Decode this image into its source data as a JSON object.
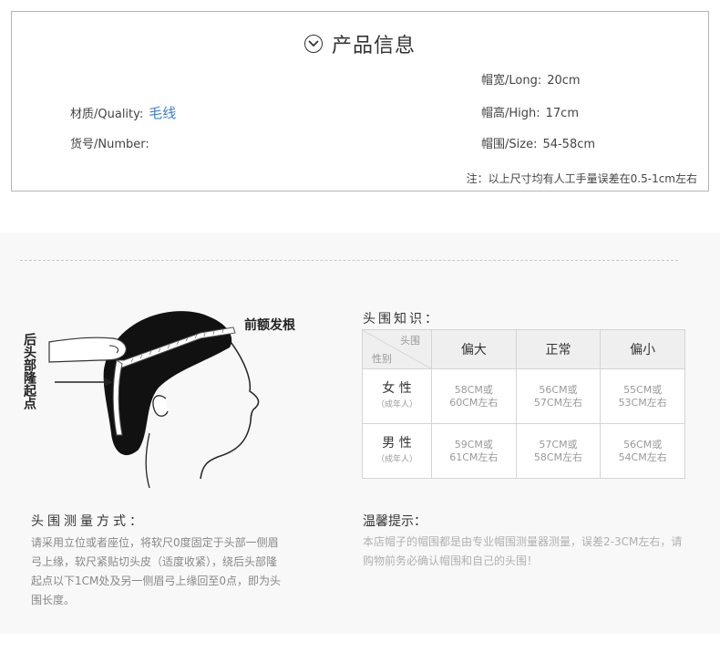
{
  "info": {
    "title": "产品信息",
    "quality_label": "材质/Quality:",
    "quality_value": "毛线",
    "number_label": "货号/Number:",
    "long_label": "帽宽/Long:",
    "long_value": "20cm",
    "high_label": "帽高/High:",
    "high_value": "17cm",
    "size_label": "帽围/Size:",
    "size_value": "54-58cm",
    "note": "注：以上尺寸均有人工手量误差在0.5-1cm左右"
  },
  "figure": {
    "label_back": "后头部隆起点",
    "label_front": "前额发根"
  },
  "knowledge": {
    "title": "头围知识：",
    "corner_top": "头围",
    "corner_bottom": "性别",
    "columns": [
      "偏大",
      "正常",
      "偏小"
    ],
    "rows": [
      {
        "gender": "女 性",
        "sub": "（成年人）",
        "cells": [
          [
            "58CM或",
            "60CM左右"
          ],
          [
            "56CM或",
            "57CM左右"
          ],
          [
            "55CM或",
            "53CM左右"
          ]
        ]
      },
      {
        "gender": "男 性",
        "sub": "（成年人）",
        "cells": [
          [
            "59CM或",
            "61CM左右"
          ],
          [
            "57CM或",
            "58CM左右"
          ],
          [
            "56CM或",
            "54CM左右"
          ]
        ]
      }
    ]
  },
  "method": {
    "title": "头围测量方式：",
    "text": "请采用立位或者座位，将软尺0度固定于头部一侧眉弓上缘，软尺紧贴切头皮（适度收紧），绕后头部隆起点以下1CM处及另一侧眉弓上缘回至0点，即为头围长度。"
  },
  "tips": {
    "title": "温馨提示：",
    "text": "本店帽子的帽围都是由专业帽围测量器测量，误差2-3CM左右，请购物前务必确认帽围和自己的头围！"
  }
}
